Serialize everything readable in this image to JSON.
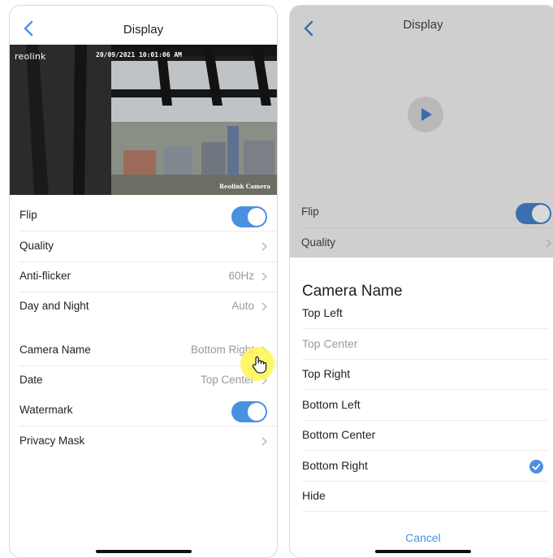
{
  "left_screen": {
    "title": "Display",
    "preview": {
      "logo": "reolink",
      "timestamp": "20/09/2021 10:01:06 AM",
      "camera_label": "Reolink Camera"
    },
    "rows": [
      {
        "label": "Flip",
        "toggle": true
      },
      {
        "label": "Quality",
        "value": ""
      },
      {
        "label": "Anti-flicker",
        "value": "60Hz"
      },
      {
        "label": "Day and Night",
        "value": "Auto"
      },
      {
        "label": "Camera Name",
        "value": "Bottom Right"
      },
      {
        "label": "Date",
        "value": "Top Center"
      },
      {
        "label": "Watermark",
        "toggle": true
      },
      {
        "label": "Privacy Mask",
        "value": ""
      }
    ]
  },
  "right_screen": {
    "title": "Display",
    "rows": [
      {
        "label": "Flip",
        "toggle": true
      },
      {
        "label": "Quality"
      }
    ],
    "sheet": {
      "title": "Camera Name",
      "options": [
        {
          "label": "Top Left",
          "selected": false,
          "muted": false
        },
        {
          "label": "Top Center",
          "selected": false,
          "muted": true
        },
        {
          "label": "Top Right",
          "selected": false,
          "muted": false
        },
        {
          "label": "Bottom Left",
          "selected": false,
          "muted": false
        },
        {
          "label": "Bottom Center",
          "selected": false,
          "muted": false
        },
        {
          "label": "Bottom Right",
          "selected": true,
          "muted": false
        },
        {
          "label": "Hide",
          "selected": false,
          "muted": false
        }
      ],
      "cancel_label": "Cancel"
    }
  },
  "colors": {
    "accent": "#4a90e2",
    "toggle_on": "#4a90e2",
    "dim_overlay": "#cfcfcf",
    "cursor_highlight": "#fff650"
  },
  "icons": [
    "back-icon",
    "chevron-icon",
    "toggle-switch",
    "play-icon",
    "check-icon",
    "hand-pointer-icon"
  ]
}
